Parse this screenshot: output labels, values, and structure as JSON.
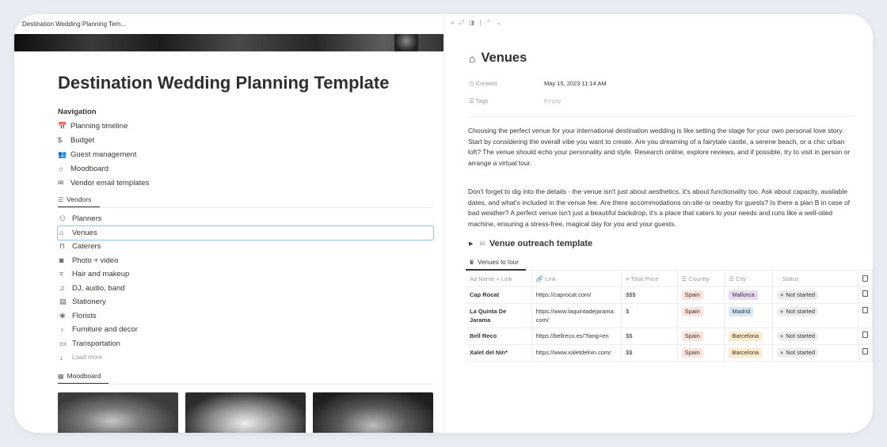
{
  "left": {
    "tab_title": "Destination Wedding Planning Tem...",
    "page_title": "Destination Wedding Planning Template",
    "nav_heading": "Navigation",
    "nav_items": [
      {
        "label": "Planning timeline",
        "icon": "calendar-icon",
        "glyph": "📅"
      },
      {
        "label": "Budget",
        "icon": "dollar-icon",
        "glyph": "$"
      },
      {
        "label": "Guest management",
        "icon": "people-icon",
        "glyph": "👥"
      },
      {
        "label": "Moodboard",
        "icon": "sun-icon",
        "glyph": "☼"
      },
      {
        "label": "Vendor email templates",
        "icon": "mail-icon",
        "glyph": "✉"
      }
    ],
    "vendors_tab": "Vendors",
    "vendors": [
      {
        "label": "Planners",
        "icon": "person-add-icon",
        "glyph": "👤"
      },
      {
        "label": "Venues",
        "icon": "home-icon",
        "glyph": "⌂"
      },
      {
        "label": "Caterers",
        "icon": "building-icon",
        "glyph": "🏛"
      },
      {
        "label": "Photo + video",
        "icon": "camera-icon",
        "glyph": "📷"
      },
      {
        "label": "Hair and makeup",
        "icon": "crop-icon",
        "glyph": "✂"
      },
      {
        "label": "DJ, audio, band",
        "icon": "music-icon",
        "glyph": "♫"
      },
      {
        "label": "Stationery",
        "icon": "stationery-icon",
        "glyph": "▤"
      },
      {
        "label": "Florists",
        "icon": "flower-icon",
        "glyph": "✿"
      },
      {
        "label": "Furniture and decor",
        "icon": "lamp-icon",
        "glyph": "♁"
      },
      {
        "label": "Transportation",
        "icon": "truck-icon",
        "glyph": "⛟"
      }
    ],
    "load_more": "Load more",
    "moodboard_tab": "Moodboard"
  },
  "right": {
    "title": "Venues",
    "props": {
      "created_label": "Created",
      "created_value": "May 15, 2023 11:14 AM",
      "tags_label": "Tags",
      "tags_value": "Empty"
    },
    "para1": "Choosing the perfect venue for your international destination wedding is like setting the stage for your own personal love story. Start by considering the overall vibe you want to create. Are you dreaming of a fairytale castle, a serene beach, or a chic urban loft? The venue should echo your personality and style. Research online, explore reviews, and if possible, try to visit in person or arrange a virtual tour.",
    "para2": "Don't forget to dig into the details - the venue isn't just about aesthetics, it's about functionality too. Ask about capacity, available dates, and what's included in the venue fee. Are there accommodations on-site or nearby for guests? Is there a plan B in case of bad weather? A perfect venue isn't just a beautiful backdrop, it's a place that caters to your needs and runs like a well-oiled machine, ensuring a stress-free, magical day for you and your guests.",
    "toggle_title": "Venue outreach template",
    "db_tab": "Venues to tour",
    "columns": [
      "Name + Link",
      "Link",
      "Total Price",
      "Country",
      "City",
      "Status"
    ],
    "rows": [
      {
        "name": "Cap Rocat",
        "link": "https://caprocat.com/",
        "price": "$$$",
        "country": "Spain",
        "city": "Mallorca",
        "status": "Not started"
      },
      {
        "name": "La Quinta De Jarama",
        "link": "https://www.laquintadejarama.com/",
        "price": "$",
        "country": "Spain",
        "city": "Madrid",
        "status": "Not started"
      },
      {
        "name": "Bell Reco",
        "link": "https://bellreco.es/?lang=en",
        "price": "$$",
        "country": "Spain",
        "city": "Barcelona",
        "status": "Not started"
      },
      {
        "name": "Xalet del Nin*",
        "link": "https://www.xaletdelnin.com/",
        "price": "$$",
        "country": "Spain",
        "city": "Barcelona",
        "status": "Not started"
      }
    ]
  },
  "colors": {
    "country_tag_bg": "#fbe4de",
    "city_mallorca_bg": "#ead9f2",
    "city_madrid_bg": "#d6e8f5",
    "city_barcelona_bg": "#fbeacb",
    "selected_outline": "#8ec1ee"
  }
}
